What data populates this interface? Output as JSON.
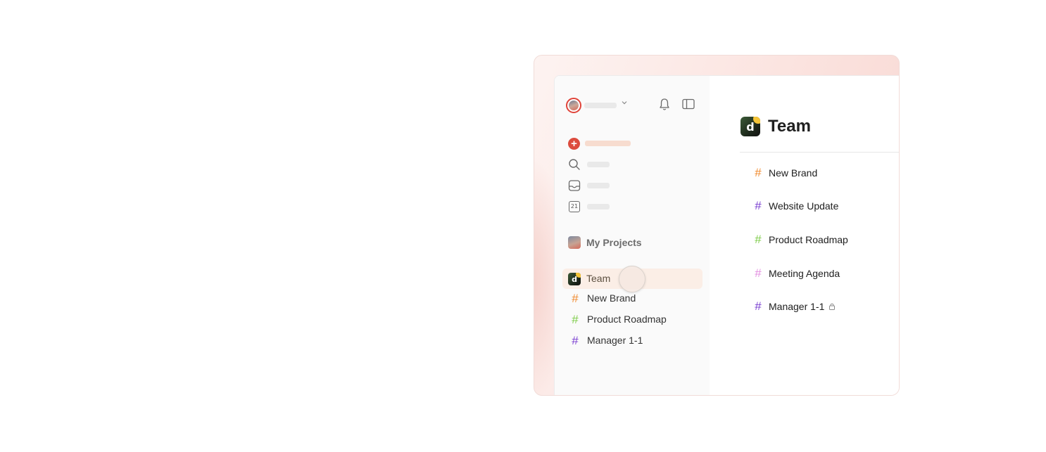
{
  "sidebar": {
    "my_projects_label": "My Projects",
    "team_label": "Team",
    "calendar_day": "21",
    "add_symbol": "+",
    "projects": [
      {
        "label": "New Brand",
        "color": "#f08a2e"
      },
      {
        "label": "Product Roadmap",
        "color": "#7ecc49"
      },
      {
        "label": "Manager 1-1",
        "color": "#7a3fd1"
      }
    ]
  },
  "main": {
    "title": "Team",
    "logo_letter": "d",
    "projects": [
      {
        "label": "New Brand",
        "color": "#f08a2e"
      },
      {
        "label": "Website Update",
        "color": "#7a3fd1"
      },
      {
        "label": "Product Roadmap",
        "color": "#7ecc49"
      },
      {
        "label": "Meeting Agenda",
        "color": "#e38fe0"
      },
      {
        "label": "Manager 1-1",
        "color": "#7a3fd1",
        "locked": true
      }
    ]
  },
  "icons": {
    "hash": "#",
    "names": [
      "avatar",
      "chevron-down-icon",
      "bell-icon",
      "sidebar-toggle-icon",
      "add-task-icon",
      "search-icon",
      "inbox-icon",
      "calendar-icon",
      "lock-icon"
    ]
  },
  "colors": {
    "accent": "#dc4c3e",
    "selected_row": "#fbeee6",
    "frame_gradient": "#fbe3df"
  }
}
